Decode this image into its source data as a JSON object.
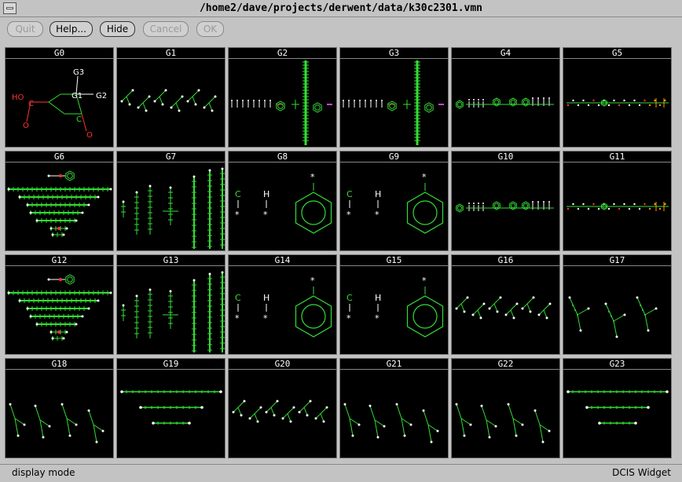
{
  "window": {
    "title": "/home2/dave/projects/derwent/data/k30c2301.vmn"
  },
  "toolbar": {
    "buttons": [
      {
        "label": "Quit",
        "enabled": false
      },
      {
        "label": "Help...",
        "enabled": true
      },
      {
        "label": "Hide",
        "enabled": true
      },
      {
        "label": "Cancel",
        "enabled": false
      },
      {
        "label": "OK",
        "enabled": false
      }
    ]
  },
  "grid": {
    "cells": [
      {
        "label": "G0",
        "kind": "acid"
      },
      {
        "label": "G1",
        "kind": "ychain"
      },
      {
        "label": "G2",
        "kind": "longchain"
      },
      {
        "label": "G3",
        "kind": "longchain"
      },
      {
        "label": "G4",
        "kind": "ringchain"
      },
      {
        "label": "G5",
        "kind": "dotchain"
      },
      {
        "label": "G6",
        "kind": "pyramid"
      },
      {
        "label": "G7",
        "kind": "columns"
      },
      {
        "label": "G8",
        "kind": "benzene"
      },
      {
        "label": "G9",
        "kind": "benzene"
      },
      {
        "label": "G10",
        "kind": "ringchain"
      },
      {
        "label": "G11",
        "kind": "dotchain"
      },
      {
        "label": "G12",
        "kind": "pyramid"
      },
      {
        "label": "G13",
        "kind": "columns"
      },
      {
        "label": "G14",
        "kind": "benzene"
      },
      {
        "label": "G15",
        "kind": "benzene"
      },
      {
        "label": "G16",
        "kind": "ychain"
      },
      {
        "label": "G17",
        "kind": "tristar"
      },
      {
        "label": "G18",
        "kind": "tristar4"
      },
      {
        "label": "G19",
        "kind": "bars"
      },
      {
        "label": "G20",
        "kind": "ychain"
      },
      {
        "label": "G21",
        "kind": "tristar4"
      },
      {
        "label": "G22",
        "kind": "tristar4"
      },
      {
        "label": "G23",
        "kind": "bars"
      }
    ],
    "acid": {
      "ho": "HO",
      "c": "C",
      "o": "O",
      "g1": "G1",
      "g2": "G2",
      "g3": "G3"
    },
    "benzene": {
      "c": "C",
      "h": "H",
      "star": "*"
    },
    "colors": {
      "bond": "#33dd33",
      "atom": "#ffffff",
      "hetero": "#ff3333",
      "accent": "#ff9900",
      "link": "#cc44cc"
    }
  },
  "status": {
    "left": "display mode",
    "right": "DCIS Widget"
  }
}
